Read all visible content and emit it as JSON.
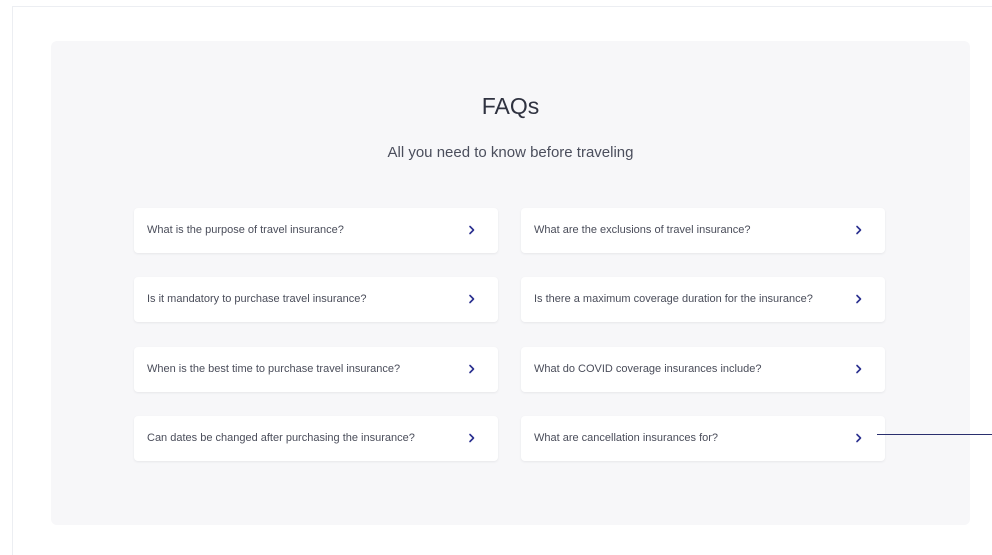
{
  "faq": {
    "title": "FAQs",
    "subtitle": "All you need to know before traveling",
    "questions": [
      "What is the purpose of travel insurance?",
      "What are the exclusions of travel insurance?",
      "Is it mandatory to purchase travel insurance?",
      "Is there a maximum coverage duration for the insurance?",
      "When is the best time to purchase travel insurance?",
      "What do COVID coverage insurances include?",
      "Can dates be changed after purchasing the insurance?",
      "What are cancellation insurances for?"
    ]
  },
  "colors": {
    "accent": "#2a2f8f",
    "section_background": "#f7f7f9",
    "card_background": "#ffffff",
    "callout_line": "#2a2f6e"
  },
  "icons": {
    "expand": "chevron-right-icon"
  }
}
